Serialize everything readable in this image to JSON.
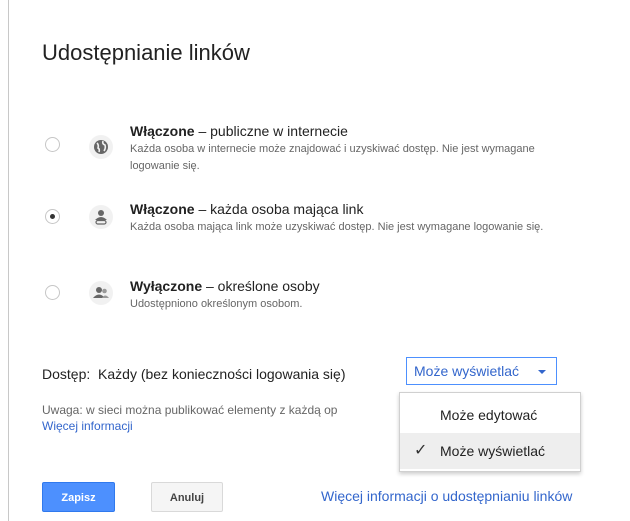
{
  "dialog": {
    "title": "Udostępnianie linków"
  },
  "options": [
    {
      "head_bold": "Włączone",
      "head_rest": " – publiczne w internecie",
      "desc": "Każda osoba w internecie może znajdować i uzyskiwać dostęp. Nie jest wymagane logowanie się.",
      "icon": "globe-icon",
      "selected": false
    },
    {
      "head_bold": "Włączone",
      "head_rest": " – każda osoba mająca link",
      "desc": "Każda osoba mająca link może uzyskiwać dostęp. Nie jest wymagane logowanie się.",
      "icon": "person-link-icon",
      "selected": true
    },
    {
      "head_bold": "Wyłączone",
      "head_rest": " – określone osoby",
      "desc": "Udostępniono określonym osobom.",
      "icon": "people-icon",
      "selected": false
    }
  ],
  "access": {
    "label": "Dostęp:  Każdy (bez konieczności logowania się)",
    "dropdown_value": "Może wyświetlać",
    "menu_items": [
      "Może edytować",
      "Może wyświetlać"
    ],
    "menu_selected": "Może wyświetlać"
  },
  "note": {
    "text": "Uwaga: w sieci można publikować elementy z każdą op",
    "link": "Więcej informacji"
  },
  "buttons": {
    "save": "Zapisz",
    "cancel": "Anuluj"
  },
  "footer_link": "Więcej informacji o udostępnianiu linków",
  "colors": {
    "accent": "#4d90fe",
    "link": "#3366cc"
  }
}
